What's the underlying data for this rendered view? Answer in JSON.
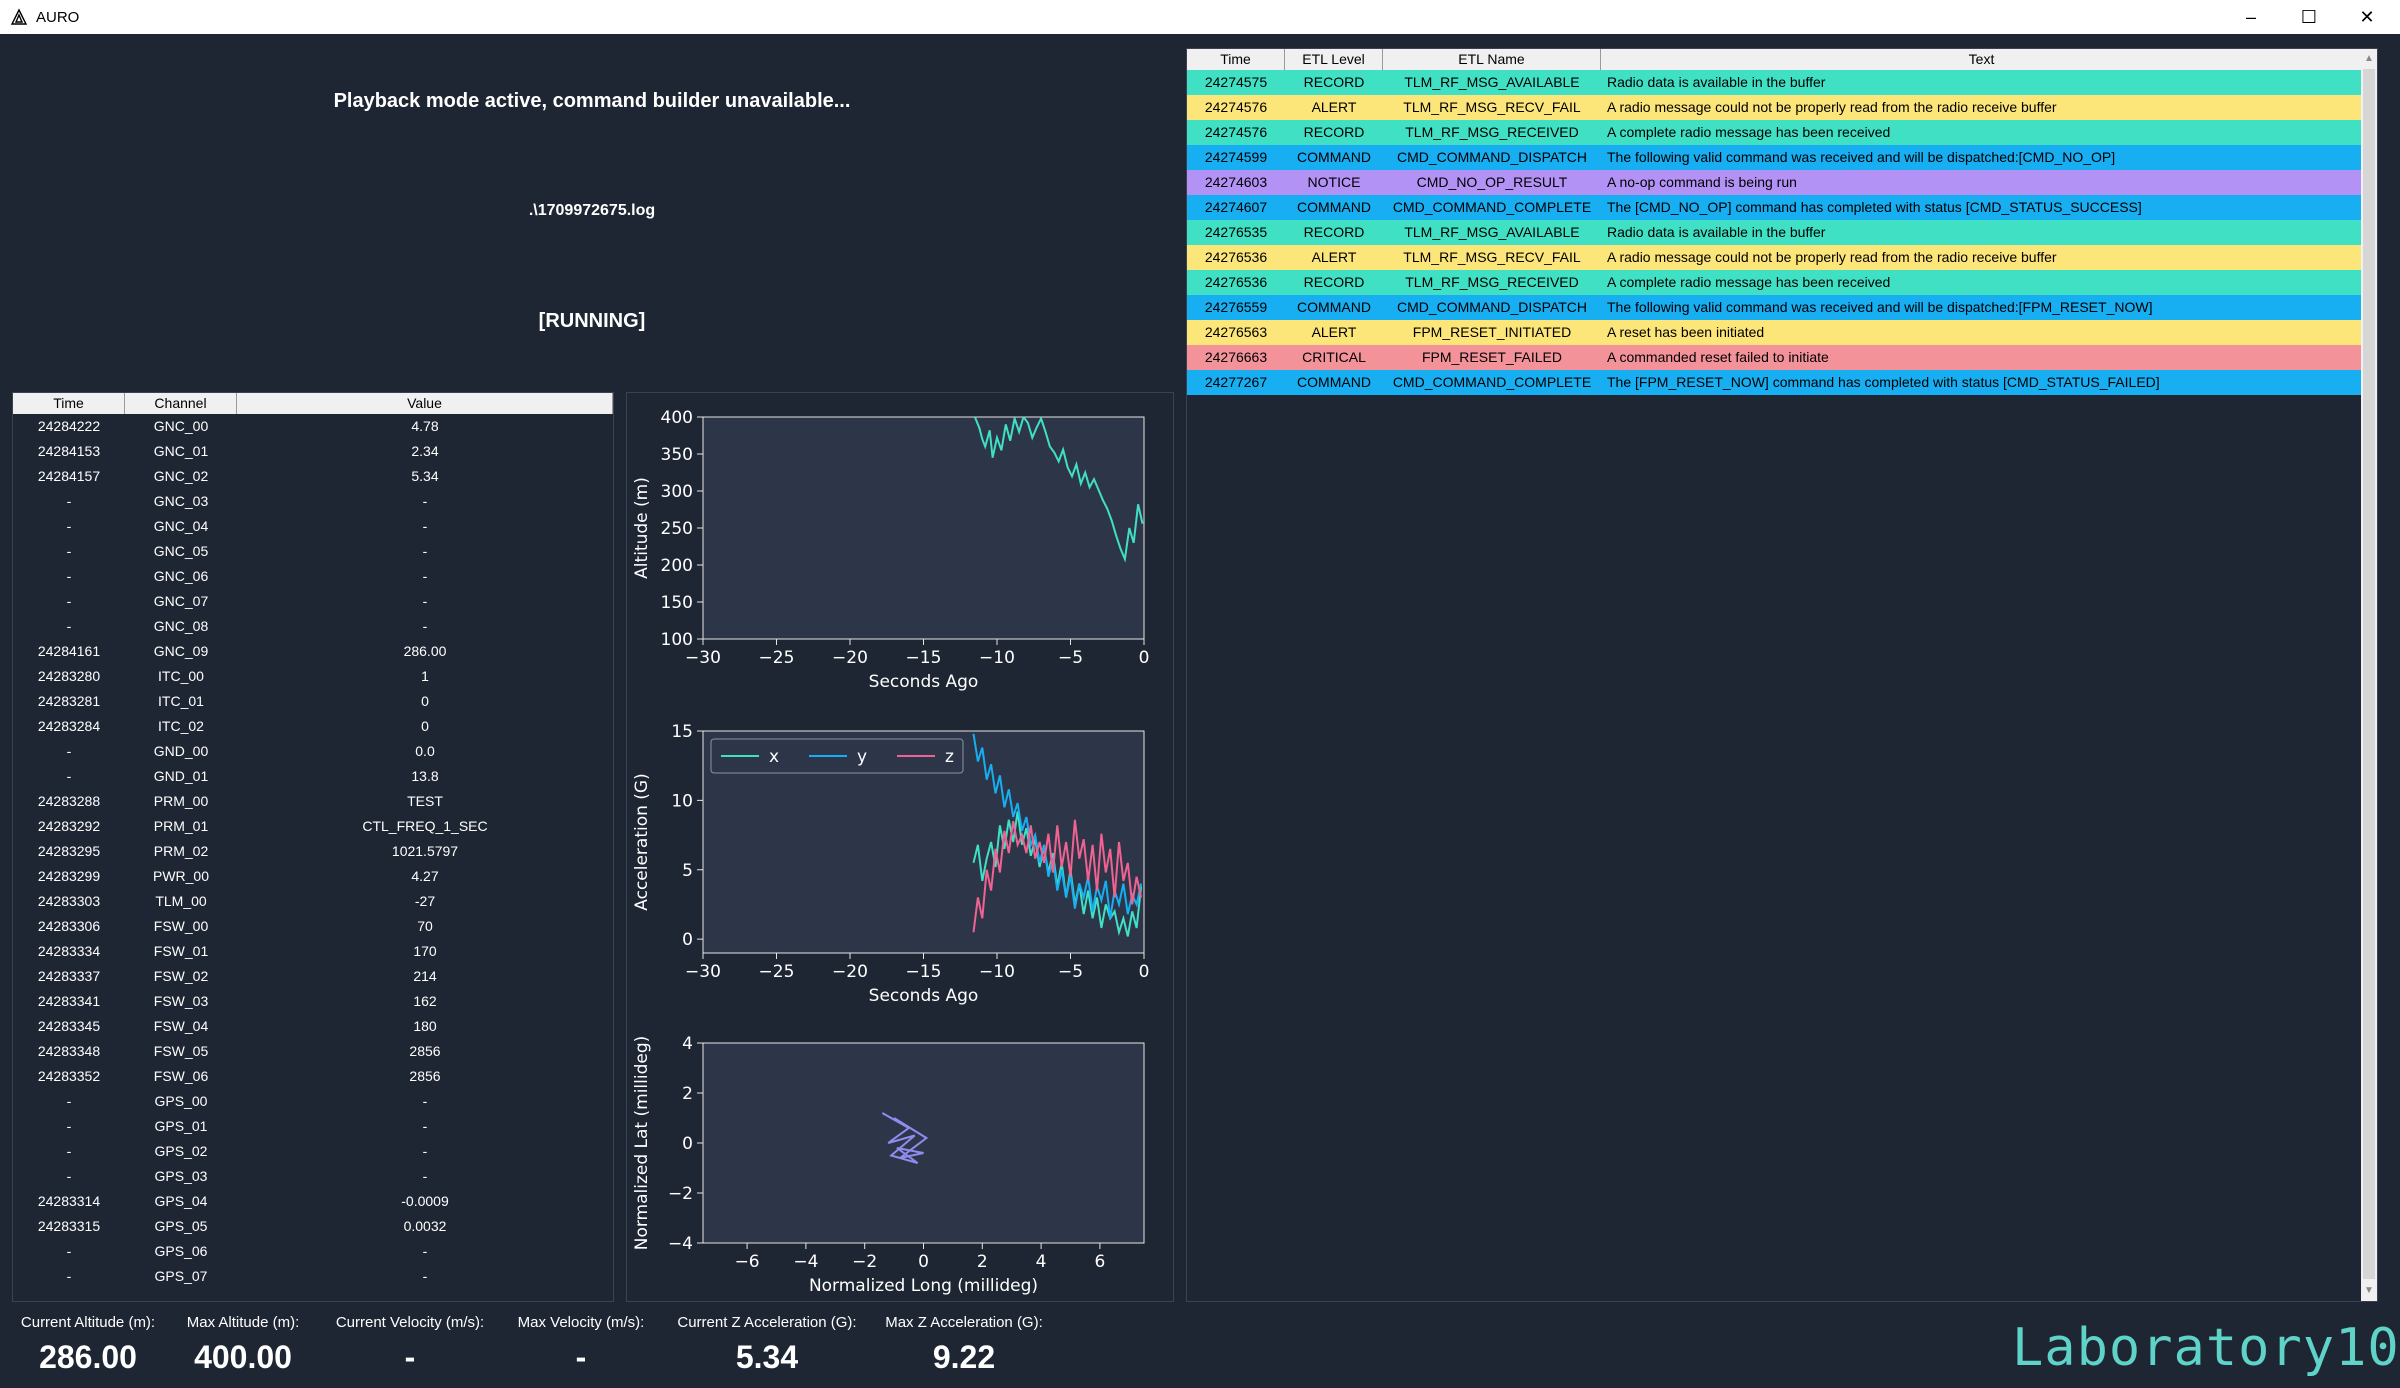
{
  "window": {
    "title": "AURO",
    "minimize": "–",
    "maximize": "☐",
    "close": "✕"
  },
  "command_panel": {
    "message": "Playback mode active, command builder unavailable...",
    "file": ".\\1709972675.log",
    "status": "[RUNNING]"
  },
  "telemetry": {
    "headers": [
      "Time",
      "Channel",
      "Value"
    ],
    "rows": [
      [
        "24284222",
        "GNC_00",
        "4.78"
      ],
      [
        "24284153",
        "GNC_01",
        "2.34"
      ],
      [
        "24284157",
        "GNC_02",
        "5.34"
      ],
      [
        "-",
        "GNC_03",
        "-"
      ],
      [
        "-",
        "GNC_04",
        "-"
      ],
      [
        "-",
        "GNC_05",
        "-"
      ],
      [
        "-",
        "GNC_06",
        "-"
      ],
      [
        "-",
        "GNC_07",
        "-"
      ],
      [
        "-",
        "GNC_08",
        "-"
      ],
      [
        "24284161",
        "GNC_09",
        "286.00"
      ],
      [
        "24283280",
        "ITC_00",
        "1"
      ],
      [
        "24283281",
        "ITC_01",
        "0"
      ],
      [
        "24283284",
        "ITC_02",
        "0"
      ],
      [
        "-",
        "GND_00",
        "0.0"
      ],
      [
        "-",
        "GND_01",
        "13.8"
      ],
      [
        "24283288",
        "PRM_00",
        "TEST"
      ],
      [
        "24283292",
        "PRM_01",
        "CTL_FREQ_1_SEC"
      ],
      [
        "24283295",
        "PRM_02",
        "1021.5797"
      ],
      [
        "24283299",
        "PWR_00",
        "4.27"
      ],
      [
        "24283303",
        "TLM_00",
        "-27"
      ],
      [
        "24283306",
        "FSW_00",
        "70"
      ],
      [
        "24283334",
        "FSW_01",
        "170"
      ],
      [
        "24283337",
        "FSW_02",
        "214"
      ],
      [
        "24283341",
        "FSW_03",
        "162"
      ],
      [
        "24283345",
        "FSW_04",
        "180"
      ],
      [
        "24283348",
        "FSW_05",
        "2856"
      ],
      [
        "24283352",
        "FSW_06",
        "2856"
      ],
      [
        "-",
        "GPS_00",
        "-"
      ],
      [
        "-",
        "GPS_01",
        "-"
      ],
      [
        "-",
        "GPS_02",
        "-"
      ],
      [
        "-",
        "GPS_03",
        "-"
      ],
      [
        "24283314",
        "GPS_04",
        "-0.0009"
      ],
      [
        "24283315",
        "GPS_05",
        "0.0032"
      ],
      [
        "-",
        "GPS_06",
        "-"
      ],
      [
        "-",
        "GPS_07",
        "-"
      ]
    ]
  },
  "events": {
    "headers": [
      "Time",
      "ETL Level",
      "ETL Name",
      "Text"
    ],
    "level_colors": {
      "RECORD": "#40e0c4",
      "ALERT": "#fce679",
      "COMMAND": "#17aef2",
      "NOTICE": "#b392f5",
      "CRITICAL": "#f4929a"
    },
    "rows": [
      [
        "24274575",
        "RECORD",
        "TLM_RF_MSG_AVAILABLE",
        "Radio data is available in the buffer"
      ],
      [
        "24274576",
        "ALERT",
        "TLM_RF_MSG_RECV_FAIL",
        "A radio message could not be properly read from the radio receive buffer"
      ],
      [
        "24274576",
        "RECORD",
        "TLM_RF_MSG_RECEIVED",
        "A complete radio message has been received"
      ],
      [
        "24274599",
        "COMMAND",
        "CMD_COMMAND_DISPATCH",
        "The following valid command was received and will be dispatched:[CMD_NO_OP]"
      ],
      [
        "24274603",
        "NOTICE",
        "CMD_NO_OP_RESULT",
        "A no-op command is being run"
      ],
      [
        "24274607",
        "COMMAND",
        "CMD_COMMAND_COMPLETE",
        "The [CMD_NO_OP] command has completed with status [CMD_STATUS_SUCCESS]"
      ],
      [
        "24276535",
        "RECORD",
        "TLM_RF_MSG_AVAILABLE",
        "Radio data is available in the buffer"
      ],
      [
        "24276536",
        "ALERT",
        "TLM_RF_MSG_RECV_FAIL",
        "A radio message could not be properly read from the radio receive buffer"
      ],
      [
        "24276536",
        "RECORD",
        "TLM_RF_MSG_RECEIVED",
        "A complete radio message has been received"
      ],
      [
        "24276559",
        "COMMAND",
        "CMD_COMMAND_DISPATCH",
        "The following valid command was received and will be dispatched:[FPM_RESET_NOW]"
      ],
      [
        "24276563",
        "ALERT",
        "FPM_RESET_INITIATED",
        "A reset has been initiated"
      ],
      [
        "24276663",
        "CRITICAL",
        "FPM_RESET_FAILED",
        "A commanded reset failed to initiate"
      ],
      [
        "24277267",
        "COMMAND",
        "CMD_COMMAND_COMPLETE",
        "The [FPM_RESET_NOW] command has completed with status [CMD_STATUS_FAILED]"
      ]
    ]
  },
  "stats": [
    {
      "label": "Current Altitude (m):",
      "value": "286.00"
    },
    {
      "label": "Max Altitude (m):",
      "value": "400.00"
    },
    {
      "label": "Current Velocity (m/s):",
      "value": "-"
    },
    {
      "label": "Max Velocity (m/s):",
      "value": "-"
    },
    {
      "label": "Current Z Acceleration (G):",
      "value": "5.34"
    },
    {
      "label": "Max Z Acceleration (G):",
      "value": "9.22"
    }
  ],
  "brand": "Laboratory10",
  "chart_data": [
    {
      "type": "line",
      "xlabel": "Seconds Ago",
      "ylabel": "Altitude (m)",
      "xlim": [
        -30,
        0
      ],
      "ylim": [
        100,
        400
      ],
      "xticks": [
        "−30",
        "−25",
        "−20",
        "−15",
        "−10",
        "−5",
        "0"
      ],
      "yticks": [
        "100",
        "150",
        "200",
        "250",
        "300",
        "350",
        "400"
      ],
      "color": "#40e0c4",
      "series": [
        {
          "x": [
            -11.5,
            -11.2,
            -11.0,
            -10.8,
            -10.5,
            -10.3,
            -10.0,
            -9.7,
            -9.4,
            -9.1,
            -8.8,
            -8.5,
            -8.2,
            -7.9,
            -7.6,
            -7.3,
            -7.0,
            -6.7,
            -6.4,
            -6.1,
            -5.8,
            -5.5,
            -5.2,
            -4.9,
            -4.6,
            -4.3,
            -4.0,
            -3.7,
            -3.4,
            -3.1,
            -2.8,
            -2.5,
            -2.2,
            -1.9,
            -1.6,
            -1.3,
            -1.0,
            -0.7,
            -0.4,
            -0.1
          ],
          "values": [
            400,
            385,
            370,
            360,
            382,
            345,
            372,
            355,
            390,
            368,
            398,
            380,
            400,
            392,
            372,
            386,
            398,
            380,
            360,
            352,
            340,
            356,
            332,
            320,
            336,
            310,
            325,
            305,
            316,
            302,
            288,
            276,
            260,
            240,
            222,
            208,
            250,
            230,
            282,
            256
          ]
        }
      ]
    },
    {
      "type": "line",
      "xlabel": "Seconds Ago",
      "ylabel": "Acceleration (G)",
      "xlim": [
        -30,
        0
      ],
      "ylim": [
        -1,
        15
      ],
      "xticks": [
        "−30",
        "−25",
        "−20",
        "−15",
        "−10",
        "−5",
        "0"
      ],
      "yticks": [
        "0",
        "5",
        "10",
        "15"
      ],
      "legend": "top-left",
      "series": [
        {
          "name": "x",
          "color": "#40e0c4",
          "x": [
            -11.6,
            -11.3,
            -11.0,
            -10.7,
            -10.4,
            -10.1,
            -9.8,
            -9.5,
            -9.2,
            -8.9,
            -8.6,
            -8.3,
            -8.0,
            -7.7,
            -7.4,
            -7.1,
            -6.8,
            -6.5,
            -6.2,
            -5.9,
            -5.6,
            -5.3,
            -5.0,
            -4.7,
            -4.4,
            -4.1,
            -3.8,
            -3.5,
            -3.2,
            -2.9,
            -2.6,
            -2.3,
            -2.0,
            -1.7,
            -1.4,
            -1.1,
            -0.8,
            -0.5,
            -0.2
          ],
          "values": [
            5.5,
            6.8,
            4.2,
            5.8,
            7.0,
            5.2,
            8.2,
            6.5,
            8.6,
            7.0,
            9.2,
            6.8,
            8.0,
            6.0,
            7.2,
            5.2,
            6.6,
            4.8,
            6.2,
            3.8,
            5.5,
            3.0,
            5.0,
            2.5,
            4.0,
            1.8,
            3.5,
            1.5,
            3.0,
            0.8,
            2.5,
            1.5,
            2.0,
            0.5,
            1.5,
            0.2,
            2.0,
            0.8,
            3.8
          ]
        },
        {
          "name": "y",
          "color": "#17aef2",
          "x": [
            -11.6,
            -11.3,
            -11.0,
            -10.7,
            -10.4,
            -10.1,
            -9.8,
            -9.5,
            -9.2,
            -8.9,
            -8.6,
            -8.3,
            -8.0,
            -7.7,
            -7.4,
            -7.1,
            -6.8,
            -6.5,
            -6.2,
            -5.9,
            -5.6,
            -5.3,
            -5.0,
            -4.7,
            -4.4,
            -4.1,
            -3.8,
            -3.5,
            -3.2,
            -2.9,
            -2.6,
            -2.3,
            -2.0,
            -1.7,
            -1.4,
            -1.1,
            -0.8,
            -0.5,
            -0.2
          ],
          "values": [
            14.8,
            12.8,
            13.8,
            11.5,
            12.6,
            10.5,
            11.8,
            9.5,
            10.8,
            8.8,
            9.8,
            7.8,
            8.8,
            6.8,
            7.5,
            5.5,
            6.8,
            4.5,
            5.8,
            3.5,
            5.0,
            3.0,
            4.6,
            2.2,
            4.0,
            3.0,
            4.5,
            2.0,
            3.8,
            2.8,
            4.2,
            1.5,
            3.5,
            2.5,
            4.0,
            1.8,
            3.2,
            2.5,
            4.0
          ]
        },
        {
          "name": "z",
          "color": "#f06292",
          "x": [
            -11.6,
            -11.3,
            -11.0,
            -10.7,
            -10.4,
            -10.1,
            -9.8,
            -9.5,
            -9.2,
            -8.9,
            -8.6,
            -8.3,
            -8.0,
            -7.7,
            -7.4,
            -7.1,
            -6.8,
            -6.5,
            -6.2,
            -5.9,
            -5.6,
            -5.3,
            -5.0,
            -4.7,
            -4.4,
            -4.1,
            -3.8,
            -3.5,
            -3.2,
            -2.9,
            -2.6,
            -2.3,
            -2.0,
            -1.7,
            -1.4,
            -1.1,
            -0.8,
            -0.5,
            -0.2
          ],
          "values": [
            0.5,
            3.0,
            1.5,
            5.0,
            3.5,
            6.5,
            4.8,
            7.8,
            6.2,
            8.5,
            6.8,
            7.5,
            6.2,
            8.2,
            5.8,
            7.0,
            5.5,
            7.6,
            4.8,
            8.2,
            5.2,
            7.0,
            4.5,
            8.6,
            5.8,
            7.2,
            4.2,
            6.8,
            3.5,
            7.6,
            4.8,
            6.5,
            3.0,
            7.0,
            4.2,
            5.5,
            2.5,
            4.5,
            3.0
          ]
        }
      ]
    },
    {
      "type": "line",
      "xlabel": "Normalized Long (millideg)",
      "ylabel": "Normalized Lat (millideg)",
      "xlim": [
        -7.5,
        7.5
      ],
      "ylim": [
        -4,
        4
      ],
      "xticks": [
        "−6",
        "−4",
        "−2",
        "0",
        "2",
        "4",
        "6"
      ],
      "yticks": [
        "−4",
        "−2",
        "0",
        "2",
        "4"
      ],
      "color": "#8f8cf0",
      "series": [
        {
          "x": [
            -1.4,
            -0.5,
            -1.2,
            -0.3,
            -1.1,
            -0.2,
            -0.9,
            0.0,
            -0.8,
            0.1,
            -1.0
          ],
          "values": [
            1.2,
            0.6,
            0.0,
            0.3,
            -0.5,
            -0.8,
            -0.2,
            -0.4,
            -0.6,
            0.2,
            1.0
          ]
        }
      ]
    }
  ]
}
